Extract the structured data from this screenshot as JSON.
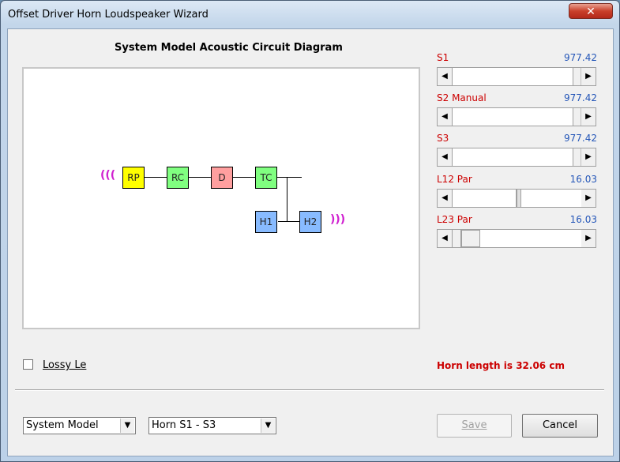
{
  "window": {
    "title": "Offset Driver Horn Loudspeaker Wizard",
    "close_glyph": "✕"
  },
  "diagram": {
    "title": "System Model Acoustic Circuit Diagram",
    "blocks": [
      {
        "label": "RP",
        "color": "#ffff00"
      },
      {
        "label": "RC",
        "color": "#80ff80"
      },
      {
        "label": "D",
        "color": "#ff9f9f"
      },
      {
        "label": "TC",
        "color": "#80ff80"
      },
      {
        "label": "H1",
        "color": "#88bbff"
      },
      {
        "label": "H2",
        "color": "#88bbff"
      }
    ],
    "wave_left": "(((",
    "wave_right": ")))"
  },
  "sliders": [
    {
      "label": "S1",
      "value": "977.42",
      "level": 0.95
    },
    {
      "label": "S2  Manual",
      "value": "977.42",
      "level": 0.95
    },
    {
      "label": "S3",
      "value": "977.42",
      "level": 0.95
    },
    {
      "label": "L12  Par",
      "value": "16.03",
      "level": 0.5
    },
    {
      "label": "L23  Par",
      "value": "16.03",
      "level": 0.1
    }
  ],
  "lossy": {
    "label": "Lossy Le",
    "checked": false
  },
  "horn_length": "Horn length is 32.06 cm",
  "model_select": {
    "value": "System Model"
  },
  "horn_select": {
    "value": "Horn S1 - S3"
  },
  "buttons": {
    "save": "Save",
    "cancel": "Cancel"
  },
  "arrows": {
    "left": "◀",
    "right": "▶",
    "down": "▼"
  },
  "colors": {
    "label_red": "#cc0000",
    "value_blue": "#2456b8",
    "wave_magenta": "#d020d0"
  }
}
